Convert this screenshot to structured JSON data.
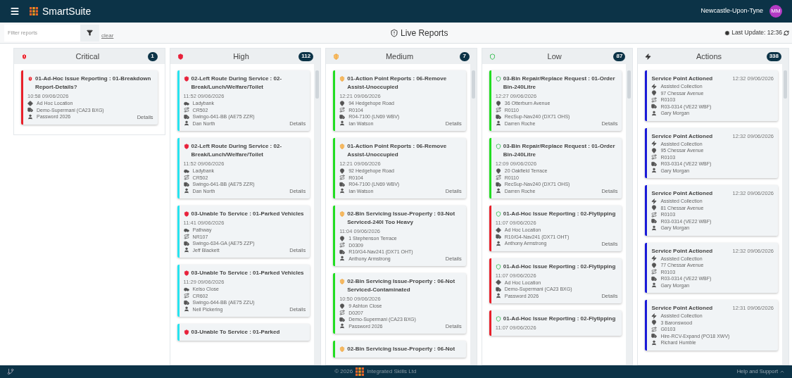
{
  "header": {
    "app_name": "SmartSuite",
    "location": "Newcastle-Upon-Tyne",
    "avatar_initials": "MM"
  },
  "toolbar": {
    "filter": {
      "placeholder": "Filter reports"
    },
    "clear_link": "clear",
    "title": "Live Reports",
    "last_update": "Last Update: 12:36"
  },
  "columns": [
    {
      "title": "Critical",
      "kind": "critical",
      "count": "1",
      "scrollable": false,
      "cards": [
        {
          "kind": "report",
          "color": "#e8202a",
          "title": "01-Ad-Hoc Issue Reporting : 01-Breakdown Report-Details?",
          "time": "10:58 09/06/2026",
          "rows": [
            {
              "kind": "adhoc",
              "text": "Ad Hoc Location"
            },
            {
              "kind": "vehicle",
              "text": "Demo-Supermani (CA23 BXG)"
            },
            {
              "kind": "driver",
              "text": "Password 2026"
            }
          ],
          "details": "Details"
        }
      ]
    },
    {
      "title": "High",
      "kind": "high",
      "count": "112",
      "scrollable": true,
      "cards": [
        {
          "kind": "report",
          "color": "#27e3ef",
          "title": "02-Left Route During Service : 02-Break/Lunch/Welfare/Toilet",
          "time": "11:52 09/06/2026",
          "rows": [
            {
              "kind": "area",
              "text": "Ladybank"
            },
            {
              "kind": "round",
              "text": "CR502"
            },
            {
              "kind": "vehicle",
              "text": "Swingo-641-BB (AE75 ZZR)"
            },
            {
              "kind": "driver",
              "text": "Dan North"
            }
          ],
          "details": "Details"
        },
        {
          "kind": "report",
          "color": "#27e3ef",
          "title": "02-Left Route During Service : 02-Break/Lunch/Welfare/Toilet",
          "time": "11:52 09/06/2026",
          "rows": [
            {
              "kind": "area",
              "text": "Ladybank"
            },
            {
              "kind": "round",
              "text": "CR502"
            },
            {
              "kind": "vehicle",
              "text": "Swingo-641-BB (AE75 ZZR)"
            },
            {
              "kind": "driver",
              "text": "Dan North"
            }
          ],
          "details": "Details"
        },
        {
          "kind": "report",
          "color": "#27e3ef",
          "title": "03-Unable To Service : 01-Parked Vehicles",
          "time": "11:41 09/06/2026",
          "rows": [
            {
              "kind": "area",
              "text": "Pathway"
            },
            {
              "kind": "round",
              "text": "NR107"
            },
            {
              "kind": "vehicle",
              "text": "Swingo-634-GA (AE75 ZZP)"
            },
            {
              "kind": "driver",
              "text": "Jeff Blackett"
            }
          ],
          "details": "Details"
        },
        {
          "kind": "report",
          "color": "#27e3ef",
          "title": "03-Unable To Service : 01-Parked Vehicles",
          "time": "11:29 09/06/2026",
          "rows": [
            {
              "kind": "area",
              "text": "Kelso Close"
            },
            {
              "kind": "round",
              "text": "CR602"
            },
            {
              "kind": "vehicle",
              "text": "Swingo-644-BB (AE75 ZZU)"
            },
            {
              "kind": "driver",
              "text": "Neil Pickering"
            }
          ],
          "details": "Details"
        },
        {
          "kind": "report",
          "color": "#27e3ef",
          "title": "03-Unable To Service : 01-Parked"
        }
      ]
    },
    {
      "title": "Medium",
      "kind": "medium",
      "count": "7",
      "scrollable": true,
      "cards": [
        {
          "kind": "report",
          "color": "#22dd22",
          "title": "01-Action Point Reports : 06-Remove Assist-Unoccupied",
          "time": "12:21 09/06/2026",
          "rows": [
            {
              "kind": "location",
              "text": "94 Hedgehope Road"
            },
            {
              "kind": "round",
              "text": "R0104"
            },
            {
              "kind": "vehicle",
              "text": "R04-7100 (LN69 WBV)"
            },
            {
              "kind": "driver",
              "text": "Ian Watson"
            }
          ],
          "details": "Details"
        },
        {
          "kind": "report",
          "color": "#22dd22",
          "title": "01-Action Point Reports : 06-Remove Assist-Unoccupied",
          "time": "12:21 09/06/2026",
          "rows": [
            {
              "kind": "location",
              "text": "92 Hedgehope Road"
            },
            {
              "kind": "round",
              "text": "R0104"
            },
            {
              "kind": "vehicle",
              "text": "R04-7100 (LN69 WBV)"
            },
            {
              "kind": "driver",
              "text": "Ian Watson"
            }
          ],
          "details": "Details"
        },
        {
          "kind": "report",
          "color": "#22dd22",
          "title": "02-Bin Servicing Issue-Property : 03-Not Serviced-240l Too Heavy",
          "time": "11:04 09/06/2026",
          "rows": [
            {
              "kind": "location",
              "text": "1 Stephenson Terrace"
            },
            {
              "kind": "round",
              "text": "D0309"
            },
            {
              "kind": "vehicle",
              "text": "R10/G4-Nav241 (DX71 OHT)"
            },
            {
              "kind": "driver",
              "text": "Anthony Armstrong"
            }
          ],
          "details": "Details"
        },
        {
          "kind": "report",
          "color": "#22dd22",
          "title": "02-Bin Servicing Issue-Property : 06-Not Serviced-Contaminated",
          "time": "10:50 09/06/2026",
          "rows": [
            {
              "kind": "location",
              "text": "9 Ashton Close"
            },
            {
              "kind": "round",
              "text": "D0207"
            },
            {
              "kind": "vehicle",
              "text": "Demo-Supermani (CA23 BXG)"
            },
            {
              "kind": "driver",
              "text": "Password 2026"
            }
          ],
          "details": "Details"
        },
        {
          "kind": "report",
          "color": "#22dd22",
          "title": "02-Bin Servicing Issue-Property : 06-Not"
        }
      ]
    },
    {
      "title": "Low",
      "kind": "low",
      "count": "87",
      "scrollable": true,
      "cards": [
        {
          "kind": "report",
          "color": "#22dd22",
          "title": "03-Bin Repair/Replace Request : 01-Order Bin-240Litre",
          "time": "12:27 09/06/2026",
          "rows": [
            {
              "kind": "location",
              "text": "36 Otterburn Avenue"
            },
            {
              "kind": "round",
              "text": "R0110"
            },
            {
              "kind": "vehicle",
              "text": "RecSup-Nav240 (DX71 OHS)"
            },
            {
              "kind": "driver",
              "text": "Darren Roche"
            }
          ],
          "details": "Details"
        },
        {
          "kind": "report",
          "color": "#22dd22",
          "title": "03-Bin Repair/Replace Request : 01-Order Bin-240Litre",
          "time": "12:09 09/06/2026",
          "rows": [
            {
              "kind": "location",
              "text": "20 Oakfield Terrace"
            },
            {
              "kind": "round",
              "text": "R0110"
            },
            {
              "kind": "vehicle",
              "text": "RecSup-Nav240 (DX71 OHS)"
            },
            {
              "kind": "driver",
              "text": "Darren Roche"
            }
          ],
          "details": "Details"
        },
        {
          "kind": "report",
          "color": "#e8202a",
          "title": "01-Ad-Hoc Issue Reporting : 02-Flytipping",
          "time": "11:07 09/06/2026",
          "rows": [
            {
              "kind": "adhoc",
              "text": "Ad Hoc Location"
            },
            {
              "kind": "vehicle",
              "text": "R10/G4-Nav241 (DX71 OHT)"
            },
            {
              "kind": "driver",
              "text": "Anthony Armstrong"
            }
          ],
          "details": "Details"
        },
        {
          "kind": "report",
          "color": "#e8202a",
          "title": "01-Ad-Hoc Issue Reporting : 02-Flytipping",
          "time": "11:07 09/06/2026",
          "rows": [
            {
              "kind": "adhoc",
              "text": "Ad Hoc Location"
            },
            {
              "kind": "vehicle",
              "text": "Demo-Supermani (CA23 BXG)"
            },
            {
              "kind": "driver",
              "text": "Password 2026"
            }
          ],
          "details": "Details"
        },
        {
          "kind": "report",
          "color": "#e8202a",
          "title": "01-Ad-Hoc Issue Reporting : 02-Flytipping",
          "time": "11:07 09/06/2026"
        }
      ]
    },
    {
      "title": "Actions",
      "kind": "actions",
      "count": "338",
      "scrollable": true,
      "cards": [
        {
          "kind": "action",
          "color": "#1a1ad8",
          "title": "Service Point Actioned",
          "time": "12:32 09/06/2026",
          "rows": [
            {
              "kind": "action",
              "text": "Assisted Collection"
            },
            {
              "kind": "location",
              "text": "97 Chessar Avenue"
            },
            {
              "kind": "round",
              "text": "R0103"
            },
            {
              "kind": "vehicle",
              "text": "R03-0314 (VE22 WBF)"
            },
            {
              "kind": "driver",
              "text": "Gary Morgan"
            }
          ]
        },
        {
          "kind": "action",
          "color": "#1a1ad8",
          "title": "Service Point Actioned",
          "time": "12:32 09/06/2026",
          "rows": [
            {
              "kind": "action",
              "text": "Assisted Collection"
            },
            {
              "kind": "location",
              "text": "95 Chessar Avenue"
            },
            {
              "kind": "round",
              "text": "R0103"
            },
            {
              "kind": "vehicle",
              "text": "R03-0314 (VE22 WBF)"
            },
            {
              "kind": "driver",
              "text": "Gary Morgan"
            }
          ]
        },
        {
          "kind": "action",
          "color": "#1a1ad8",
          "title": "Service Point Actioned",
          "time": "12:32 09/06/2026",
          "rows": [
            {
              "kind": "action",
              "text": "Assisted Collection"
            },
            {
              "kind": "location",
              "text": "81 Chessar Avenue"
            },
            {
              "kind": "round",
              "text": "R0103"
            },
            {
              "kind": "vehicle",
              "text": "R03-0314 (VE22 WBF)"
            },
            {
              "kind": "driver",
              "text": "Gary Morgan"
            }
          ]
        },
        {
          "kind": "action",
          "color": "#1a1ad8",
          "title": "Service Point Actioned",
          "time": "12:32 09/06/2026",
          "rows": [
            {
              "kind": "action",
              "text": "Assisted Collection"
            },
            {
              "kind": "location",
              "text": "77 Chessar Avenue"
            },
            {
              "kind": "round",
              "text": "R0103"
            },
            {
              "kind": "vehicle",
              "text": "R03-0314 (VE22 WBF)"
            },
            {
              "kind": "driver",
              "text": "Gary Morgan"
            }
          ]
        },
        {
          "kind": "action",
          "color": "#1a1ad8",
          "title": "Service Point Actioned",
          "time": "12:31 09/06/2026",
          "rows": [
            {
              "kind": "action",
              "text": "Assisted Collection"
            },
            {
              "kind": "location",
              "text": "3 Baronswood"
            },
            {
              "kind": "round",
              "text": "G0103"
            },
            {
              "kind": "vehicle",
              "text": "Hire-RCV-Expand (PO18 XWV)"
            },
            {
              "kind": "driver",
              "text": "Richard Humble"
            }
          ]
        }
      ]
    }
  ],
  "footer": {
    "copyright": "© 2026",
    "company": "Integrated Skills Ltd",
    "help": "Help and Support"
  }
}
